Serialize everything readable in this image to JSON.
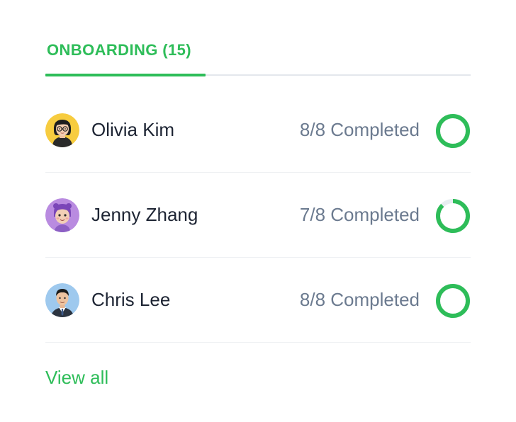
{
  "tabs": [
    {
      "label": "ONBOARDING (15)",
      "active": true
    }
  ],
  "colors": {
    "accent": "#2ebd59",
    "ring_track": "#e8edf1",
    "text_primary": "#1d2433",
    "text_secondary": "#6b7a8f"
  },
  "people": [
    {
      "name": "Olivia Kim",
      "status": "8/8 Completed",
      "completed": 8,
      "total": 8,
      "avatar_icon": "woman-glasses-avatar-icon"
    },
    {
      "name": "Jenny Zhang",
      "status": "7/8 Completed",
      "completed": 7,
      "total": 8,
      "avatar_icon": "memoji-avatar-icon"
    },
    {
      "name": "Chris Lee",
      "status": "8/8 Completed",
      "completed": 8,
      "total": 8,
      "avatar_icon": "man-suit-avatar-icon"
    }
  ],
  "footer": {
    "view_all_label": "View all"
  }
}
